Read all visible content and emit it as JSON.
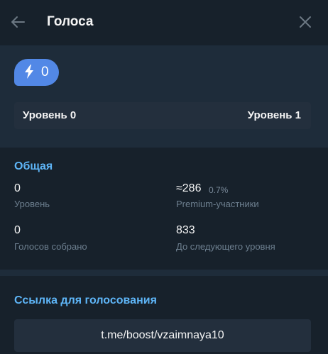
{
  "header": {
    "title": "Голоса",
    "back_icon": "arrow-left-icon",
    "close_icon": "close-icon"
  },
  "boost": {
    "count": "0",
    "icon": "lightning-bolt-icon",
    "badge_color": "#5288e6",
    "level_current": "Уровень 0",
    "level_next": "Уровень 1"
  },
  "overview": {
    "title": "Общая",
    "stats": [
      {
        "value": "0",
        "extra": "",
        "label": "Уровень"
      },
      {
        "value": "≈286",
        "extra": "0.7%",
        "label": "Premium-участники"
      },
      {
        "value": "0",
        "extra": "",
        "label": "Голосов собрано"
      },
      {
        "value": "833",
        "extra": "",
        "label": "До следующего уровня"
      }
    ]
  },
  "link": {
    "title": "Ссылка для голосования",
    "url": "t.me/boost/vzaimnaya10"
  },
  "colors": {
    "background": "#17212b",
    "section_bg": "#1e2c3a",
    "accent": "#5eb5f7"
  }
}
